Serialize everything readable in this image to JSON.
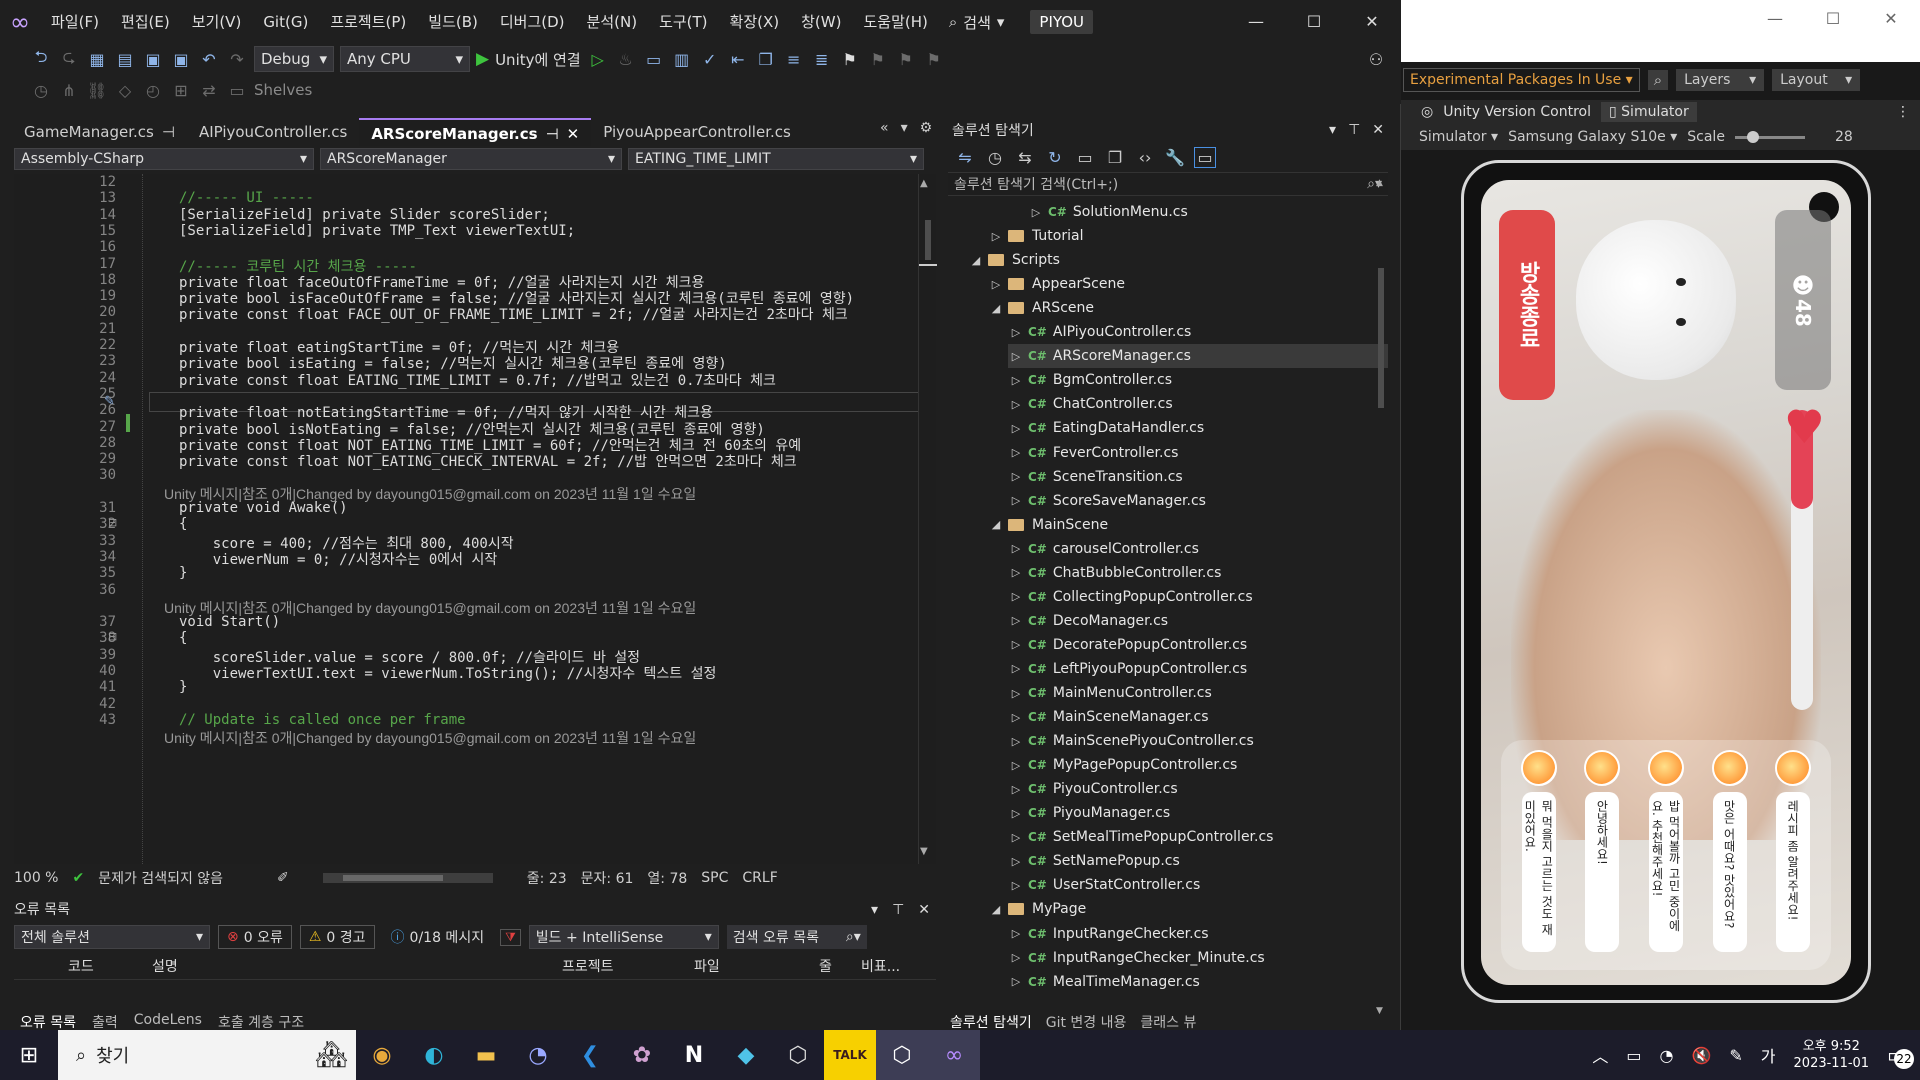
{
  "vs": {
    "menu": [
      "파일(F)",
      "편집(E)",
      "보기(V)",
      "Git(G)",
      "프로젝트(P)",
      "빌드(B)",
      "디버그(D)",
      "분석(N)",
      "도구(T)",
      "확장(X)",
      "창(W)",
      "도움말(H)"
    ],
    "search_label": "검색",
    "solution_badge": "PIYOU",
    "config": "Debug",
    "platform": "Any CPU",
    "run_label": "Unity에 연결",
    "shelves_label": "Shelves",
    "tabs": [
      {
        "label": "GameManager.cs",
        "active": false
      },
      {
        "label": "AIPiyouController.cs",
        "active": false
      },
      {
        "label": "ARScoreManager.cs",
        "active": true
      },
      {
        "label": "PiyouAppearController.cs",
        "active": false
      }
    ],
    "nav": {
      "project": "Assembly-CSharp",
      "class": "ARScoreManager",
      "member": "EATING_TIME_LIMIT"
    },
    "code_lines": [
      {
        "n": "12",
        "t": "",
        "k": ""
      },
      {
        "n": "13",
        "t": "//----- UI -----",
        "k": "cm"
      },
      {
        "n": "14",
        "t": "[SerializeField] private Slider scoreSlider;",
        "k": ""
      },
      {
        "n": "15",
        "t": "[SerializeField] private TMP_Text viewerTextUI;",
        "k": ""
      },
      {
        "n": "16",
        "t": "",
        "k": ""
      },
      {
        "n": "17",
        "t": "//----- 코루틴 시간 체크용 -----",
        "k": "cm"
      },
      {
        "n": "18",
        "t": "private float faceOutOfFrameTime = 0f; //얼굴 사라지는지 시간 체크용",
        "k": ""
      },
      {
        "n": "19",
        "t": "private bool isFaceOutOfFrame = false; //얼굴 사라지는지 실시간 체크용(코루틴 종료에 영향)",
        "k": ""
      },
      {
        "n": "20",
        "t": "private const float FACE_OUT_OF_FRAME_TIME_LIMIT = 2f; //얼굴 사라지는건 2초마다 체크",
        "k": ""
      },
      {
        "n": "21",
        "t": "",
        "k": ""
      },
      {
        "n": "22",
        "t": "private float eatingStartTime = 0f; //먹는지 시간 체크용",
        "k": ""
      },
      {
        "n": "23",
        "t": "private bool isEating = false; //먹는지 실시간 체크용(코루틴 종료에 영향)",
        "k": ""
      },
      {
        "n": "24",
        "t": "private const float EATING_TIME_LIMIT = 0.7f; //밥먹고 있는건 0.7초마다 체크",
        "k": ""
      },
      {
        "n": "25",
        "t": "",
        "k": ""
      },
      {
        "n": "26",
        "t": "private float notEatingStartTime = 0f; //먹지 않기 시작한 시간 체크용",
        "k": ""
      },
      {
        "n": "27",
        "t": "private bool isNotEating = false; //안먹는지 실시간 체크용(코루틴 종료에 영향)",
        "k": ""
      },
      {
        "n": "28",
        "t": "private const float NOT_EATING_TIME_LIMIT = 60f; //안먹는건 체크 전 60초의 유예",
        "k": ""
      },
      {
        "n": "29",
        "t": "private const float NOT_EATING_CHECK_INTERVAL = 2f; //밥 안먹으면 2초마다 체크",
        "k": ""
      },
      {
        "n": "30",
        "t": "",
        "k": ""
      },
      {
        "n": "",
        "t": "Unity 메시지|참조 0개|Changed by dayoung015@gmail.com on 2023년 11월 1일 수요일",
        "k": "lens"
      },
      {
        "n": "31",
        "t": "private void Awake()",
        "k": ""
      },
      {
        "n": "32",
        "t": "{",
        "k": ""
      },
      {
        "n": "33",
        "t": "    score = 400; //점수는 최대 800, 400시작",
        "k": ""
      },
      {
        "n": "34",
        "t": "    viewerNum = 0; //시청자수는 0에서 시작",
        "k": ""
      },
      {
        "n": "35",
        "t": "}",
        "k": ""
      },
      {
        "n": "36",
        "t": "",
        "k": ""
      },
      {
        "n": "",
        "t": "Unity 메시지|참조 0개|Changed by dayoung015@gmail.com on 2023년 11월 1일 수요일",
        "k": "lens"
      },
      {
        "n": "37",
        "t": "void Start()",
        "k": ""
      },
      {
        "n": "38",
        "t": "{",
        "k": ""
      },
      {
        "n": "39",
        "t": "    scoreSlider.value = score / 800.0f; //슬라이드 바 설정",
        "k": ""
      },
      {
        "n": "40",
        "t": "    viewerTextUI.text = viewerNum.ToString(); //시청자수 텍스트 설정",
        "k": ""
      },
      {
        "n": "41",
        "t": "}",
        "k": ""
      },
      {
        "n": "42",
        "t": "",
        "k": ""
      },
      {
        "n": "43",
        "t": "// Update is called once per frame",
        "k": "cm"
      },
      {
        "n": "",
        "t": "Unity 메시지|참조 0개|Changed by dayoung015@gmail.com on 2023년 11월 1일 수요일",
        "k": "lens"
      }
    ],
    "status": {
      "zoom": "100 %",
      "issues": "문제가 검색되지 않음",
      "line": "줄: 23",
      "char": "문자: 61",
      "col": "열: 78",
      "spc": "SPC",
      "crlf": "CRLF"
    },
    "errors": {
      "title": "오류 목록",
      "scope": "전체 솔루션",
      "errors": "0 오류",
      "warnings": "0 경고",
      "messages": "0/18 메시지",
      "build": "빌드 + IntelliSense",
      "search": "검색 오류 목록",
      "columns": [
        "코드",
        "설명",
        "프로젝트",
        "파일",
        "줄",
        "비표..."
      ]
    },
    "bottom_tabs": [
      "오류 목록",
      "출력",
      "CodeLens",
      "호출 계층 구조"
    ],
    "solution": {
      "title": "솔루션 탐색기",
      "search": "솔루션 탐색기 검색(Ctrl+;)",
      "tabs": [
        "솔루션 탐색기",
        "Git 변경 내용",
        "클래스 뷰"
      ],
      "nodes": [
        {
          "label": "SolutionMenu.cs",
          "type": "cs",
          "depth": 5,
          "exp": "right",
          "sel": false
        },
        {
          "label": "Tutorial",
          "type": "folder",
          "depth": 3,
          "exp": "right",
          "sel": false
        },
        {
          "label": "Scripts",
          "type": "folder",
          "depth": 2,
          "exp": "down",
          "sel": false
        },
        {
          "label": "AppearScene",
          "type": "folder",
          "depth": 3,
          "exp": "right",
          "sel": false
        },
        {
          "label": "ARScene",
          "type": "folder",
          "depth": 3,
          "exp": "down",
          "sel": false
        },
        {
          "label": "AIPiyouController.cs",
          "type": "cs",
          "depth": 4,
          "exp": "right",
          "sel": false
        },
        {
          "label": "ARScoreManager.cs",
          "type": "cs",
          "depth": 4,
          "exp": "right",
          "sel": true
        },
        {
          "label": "BgmController.cs",
          "type": "cs",
          "depth": 4,
          "exp": "right",
          "sel": false
        },
        {
          "label": "ChatController.cs",
          "type": "cs",
          "depth": 4,
          "exp": "right",
          "sel": false
        },
        {
          "label": "EatingDataHandler.cs",
          "type": "cs",
          "depth": 4,
          "exp": "right",
          "sel": false
        },
        {
          "label": "FeverController.cs",
          "type": "cs",
          "depth": 4,
          "exp": "right",
          "sel": false
        },
        {
          "label": "SceneTransition.cs",
          "type": "cs",
          "depth": 4,
          "exp": "right",
          "sel": false
        },
        {
          "label": "ScoreSaveManager.cs",
          "type": "cs",
          "depth": 4,
          "exp": "right",
          "sel": false
        },
        {
          "label": "MainScene",
          "type": "folder",
          "depth": 3,
          "exp": "down",
          "sel": false
        },
        {
          "label": "carouselController.cs",
          "type": "cs",
          "depth": 4,
          "exp": "right",
          "sel": false
        },
        {
          "label": "ChatBubbleController.cs",
          "type": "cs",
          "depth": 4,
          "exp": "right",
          "sel": false
        },
        {
          "label": "CollectingPopupController.cs",
          "type": "cs",
          "depth": 4,
          "exp": "right",
          "sel": false
        },
        {
          "label": "DecoManager.cs",
          "type": "cs",
          "depth": 4,
          "exp": "right",
          "sel": false
        },
        {
          "label": "DecoratePopupController.cs",
          "type": "cs",
          "depth": 4,
          "exp": "right",
          "sel": false
        },
        {
          "label": "LeftPiyouPopupController.cs",
          "type": "cs",
          "depth": 4,
          "exp": "right",
          "sel": false
        },
        {
          "label": "MainMenuController.cs",
          "type": "cs",
          "depth": 4,
          "exp": "right",
          "sel": false
        },
        {
          "label": "MainSceneManager.cs",
          "type": "cs",
          "depth": 4,
          "exp": "right",
          "sel": false
        },
        {
          "label": "MainScenePiyouController.cs",
          "type": "cs",
          "depth": 4,
          "exp": "right",
          "sel": false
        },
        {
          "label": "MyPagePopupController.cs",
          "type": "cs",
          "depth": 4,
          "exp": "right",
          "sel": false
        },
        {
          "label": "PiyouController.cs",
          "type": "cs",
          "depth": 4,
          "exp": "right",
          "sel": false
        },
        {
          "label": "PiyouManager.cs",
          "type": "cs",
          "depth": 4,
          "exp": "right",
          "sel": false
        },
        {
          "label": "SetMealTimePopupController.cs",
          "type": "cs",
          "depth": 4,
          "exp": "right",
          "sel": false
        },
        {
          "label": "SetNamePopup.cs",
          "type": "cs",
          "depth": 4,
          "exp": "right",
          "sel": false
        },
        {
          "label": "UserStatController.cs",
          "type": "cs",
          "depth": 4,
          "exp": "right",
          "sel": false
        },
        {
          "label": "MyPage",
          "type": "folder",
          "depth": 3,
          "exp": "down",
          "sel": false
        },
        {
          "label": "InputRangeChecker.cs",
          "type": "cs",
          "depth": 4,
          "exp": "right",
          "sel": false
        },
        {
          "label": "InputRangeChecker_Minute.cs",
          "type": "cs",
          "depth": 4,
          "exp": "right",
          "sel": false
        },
        {
          "label": "MealTimeManager.cs",
          "type": "cs",
          "depth": 4,
          "exp": "right",
          "sel": false
        }
      ]
    }
  },
  "unity": {
    "experimental": "Experimental Packages In Use",
    "layers": "Layers",
    "layout": "Layout",
    "tab_vc": "Unity Version Control",
    "tab_sim": "Simulator",
    "sim_mode": "Simulator",
    "device": "Samsung Galaxy S10e",
    "scale_label": "Scale",
    "scale_value": "28",
    "game": {
      "end_button": "방송종료",
      "viewer_count": "48",
      "heart_level": 0.33,
      "chips": [
        "뭐 먹을지 고르는 것도 재미있어요.",
        "안녕하세요!",
        "밥 먹어볼까 고민 중이에요. 추천해주세요!",
        "맛은 어때요? 맛있어요?",
        "레시피 좀 알려주세요!"
      ]
    }
  },
  "taskbar": {
    "search": "찾기",
    "time_line1": "오후 9:52",
    "time_line2": "2023-11-01",
    "ime": "가",
    "notif": "22",
    "apps": [
      "chrome-icon",
      "edge-icon",
      "explorer-icon",
      "obs-icon",
      "vscode-icon",
      "paint-icon",
      "notion-icon",
      "app-icon",
      "unity-hub-icon",
      "kakaotalk-icon",
      "unity-icon",
      "visualstudio-icon"
    ]
  }
}
